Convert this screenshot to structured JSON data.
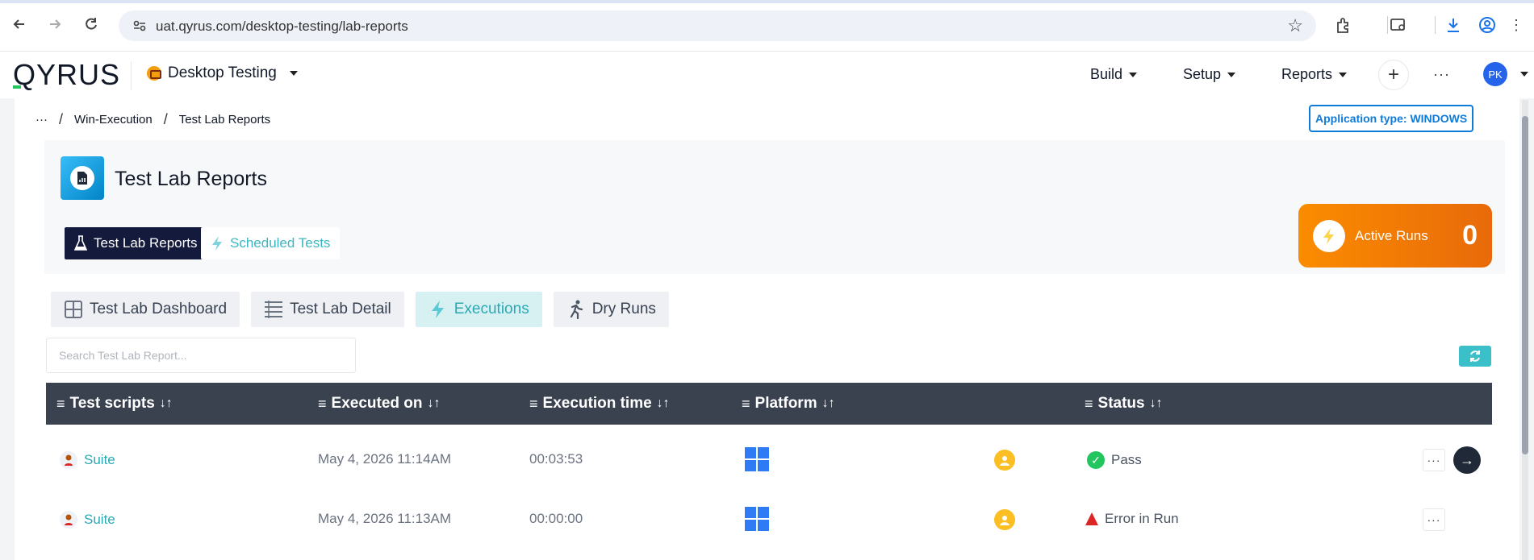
{
  "browser": {
    "url": "uat.qyrus.com/desktop-testing/lab-reports"
  },
  "header": {
    "logo": "QYRUS",
    "workspace": "Desktop Testing",
    "menu": [
      "Build",
      "Setup",
      "Reports"
    ],
    "avatar_initials": "PK"
  },
  "breadcrumb": {
    "ellipsis": "···",
    "items": [
      "Win-Execution",
      "Test Lab Reports"
    ],
    "separator": "/"
  },
  "app_type": "Application type: WINDOWS",
  "page": {
    "title": "Test Lab Reports",
    "tabs": [
      "Test Lab Reports",
      "Scheduled Tests"
    ],
    "active_runs_label": "Active Runs",
    "active_runs_count": "0",
    "subtabs": [
      "Test Lab Dashboard",
      "Test Lab Detail",
      "Executions",
      "Dry Runs"
    ],
    "selected_subtab": "Executions",
    "search_placeholder": "Search Test Lab Report..."
  },
  "table": {
    "columns": [
      "Test scripts",
      "Executed on",
      "Execution time",
      "Platform",
      "Status"
    ],
    "rows": [
      {
        "script": "Suite",
        "executed_on": "May 4, 2026 11:14AM",
        "execution_time": "00:03:53",
        "platform": "windows",
        "status": "Pass"
      },
      {
        "script": "Suite",
        "executed_on": "May 4, 2026 11:13AM",
        "execution_time": "00:00:00",
        "platform": "windows",
        "status": "Error in Run"
      }
    ]
  },
  "colors": {
    "accent_teal": "#3ab7c2",
    "brand_navy": "#131a3b",
    "table_header": "#3a4250",
    "active_runs_orange": "#fb8c00",
    "windows_blue": "#2f7bf5"
  },
  "icons": {
    "back": "back-arrow-icon",
    "forward": "forward-arrow-icon",
    "reload": "reload-icon",
    "star": "bookmark-star-icon",
    "bolt": "lightning-icon",
    "refresh": "refresh-icon"
  }
}
